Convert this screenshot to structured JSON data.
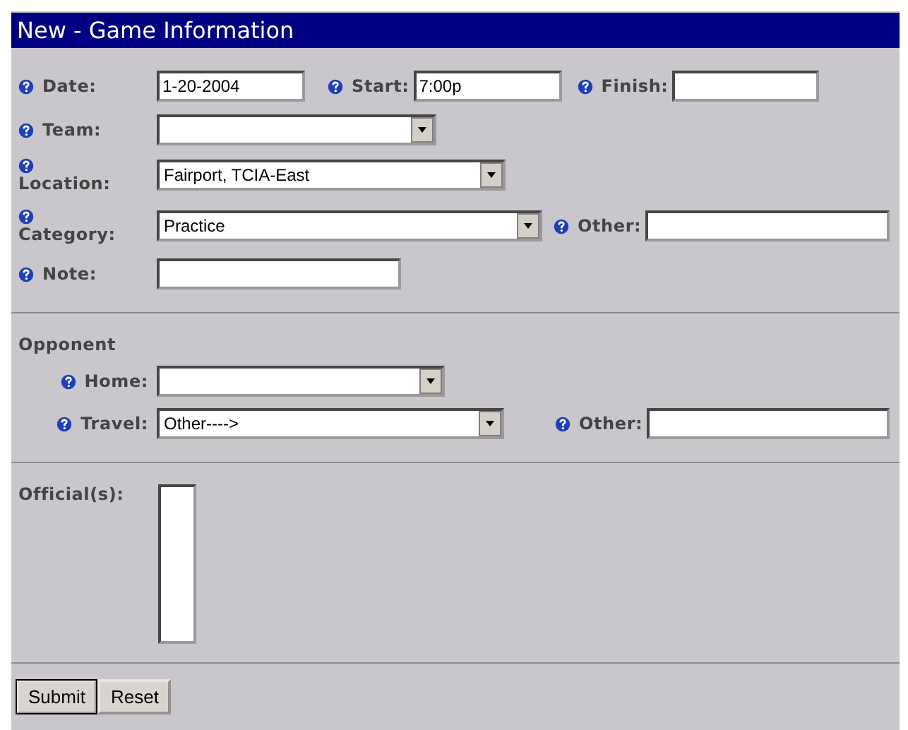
{
  "title": "New - Game Information",
  "details": [
    [
      {
        "label": "Date:",
        "kind": "text",
        "value": "1-20-2004"
      },
      {
        "label": "Start:",
        "kind": "text",
        "value": "7:00p"
      },
      {
        "label": "Finish:",
        "kind": "text"
      }
    ],
    [
      {
        "label": "Team:",
        "kind": "select"
      }
    ],
    [
      {
        "label": "Location:",
        "kind": "select",
        "value": "Fairport, TCIA-East"
      }
    ],
    [
      {
        "label": "Category:",
        "kind": "select",
        "value": "Practice"
      },
      {
        "label": "Other:",
        "kind": "text"
      }
    ],
    [
      {
        "label": "Note:",
        "kind": "text"
      }
    ]
  ],
  "opponent": {
    "heading": "Opponent",
    "rows": [
      [
        {
          "label": "Home:",
          "kind": "select"
        }
      ],
      [
        {
          "label": "Travel:",
          "kind": "select",
          "value": "Other---->"
        },
        {
          "label": "Other:",
          "kind": "text"
        }
      ]
    ]
  },
  "officials": {
    "label": "Official(s):",
    "kind": "listbox"
  },
  "buttons": [
    {
      "label": "Submit",
      "default": true
    },
    {
      "label": "Reset",
      "default": false
    }
  ]
}
